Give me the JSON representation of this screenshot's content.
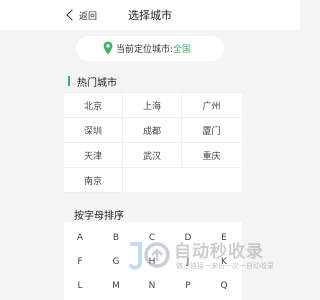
{
  "header": {
    "back_label": "返回",
    "title": "选择城市"
  },
  "location": {
    "label": "当前定位城市:",
    "value": "全国",
    "accent_color": "#3cb371",
    "icon": "location-pin-icon"
  },
  "hot_cities": {
    "title": "热门城市",
    "cities": [
      "北京",
      "上海",
      "广州",
      "深圳",
      "成都",
      "厦门",
      "天津",
      "武汉",
      "重庆",
      "南京"
    ]
  },
  "alphabet": {
    "title": "按字母排序",
    "letters": [
      "A",
      "B",
      "C",
      "D",
      "E",
      "F",
      "G",
      "H",
      "J",
      "K",
      "L",
      "M",
      "N",
      "P",
      "Q"
    ]
  },
  "watermark": {
    "title": "自动秒收录",
    "subtitle": "做上链接一来访一次一自动收录"
  }
}
